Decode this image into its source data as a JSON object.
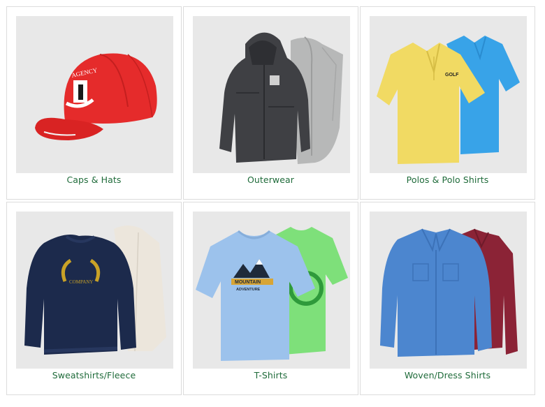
{
  "categories": [
    {
      "label": "Caps & Hats",
      "image": "red-cap-image",
      "logo_text": "AGENCY"
    },
    {
      "label": "Outerwear",
      "image": "jacket-vest-image"
    },
    {
      "label": "Polos & Polo Shirts",
      "image": "polo-shirts-image",
      "logo_text": "GOLF"
    },
    {
      "label": "Sweatshirts/Fleece",
      "image": "sweatshirt-fleece-image",
      "logo_text": "COMPANY"
    },
    {
      "label": "T-Shirts",
      "image": "tshirts-image",
      "logo_text": "MOUNTAIN",
      "logo_sub": "ADVENTURE"
    },
    {
      "label": "Woven/Dress Shirts",
      "image": "dress-shirts-image"
    }
  ],
  "colors": {
    "label_green": "#1f6b3a",
    "card_border": "#dcdcdc",
    "image_bg": "#e8e8e8"
  }
}
